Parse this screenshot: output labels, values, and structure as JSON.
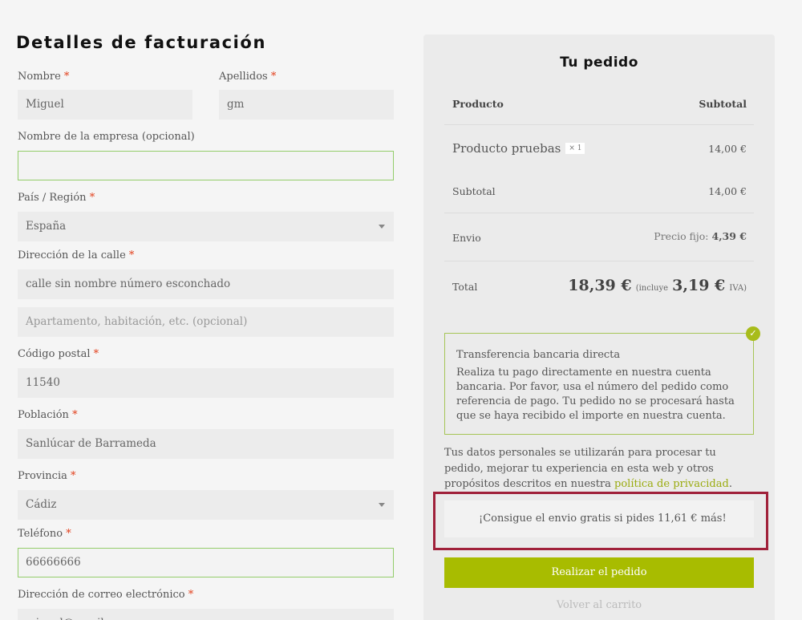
{
  "billing": {
    "title": "Detalles de facturación",
    "first_name": {
      "label": "Nombre",
      "value": "Miguel"
    },
    "last_name": {
      "label": "Apellidos",
      "value": "gm"
    },
    "company": {
      "label": "Nombre de la empresa (opcional)",
      "value": ""
    },
    "country": {
      "label": "País / Región",
      "value": "España"
    },
    "street": {
      "label": "Dirección de la calle",
      "value": "calle sin nombre número esconchado"
    },
    "apartment": {
      "placeholder": "Apartamento, habitación, etc. (opcional)"
    },
    "postcode": {
      "label": "Código postal",
      "value": "11540"
    },
    "city": {
      "label": "Población",
      "value": "Sanlúcar de Barrameda"
    },
    "state": {
      "label": "Provincia",
      "value": "Cádiz"
    },
    "phone": {
      "label": "Teléfono",
      "value": "66666666"
    },
    "email": {
      "label": "Dirección de correo electrónico",
      "value": "miguel@email.com"
    },
    "required_mark": "*"
  },
  "order": {
    "title": "Tu pedido",
    "header_product": "Producto",
    "header_subtotal": "Subtotal",
    "item_name": "Producto pruebas",
    "item_qty": "× 1",
    "item_price": "14,00 €",
    "subtotal_label": "Subtotal",
    "subtotal_value": "14,00 €",
    "shipping_label": "Envio",
    "shipping_method": "Precio fijo:",
    "shipping_value": "4,39 €",
    "total_label": "Total",
    "total_value": "18,39 €",
    "tax_prefix": "(incluye",
    "tax_value": "3,19 €",
    "tax_suffix": "IVA)",
    "payment_title": "Transferencia bancaria directa",
    "payment_desc": "Realiza tu pago directamente en nuestra cuenta bancaria. Por favor, usa el número del pedido como referencia de pago. Tu pedido no se procesará hasta que se haya recibido el importe en nuestra cuenta.",
    "privacy_text": "Tus datos personales se utilizarán para procesar tu pedido, mejorar tu experiencia en esta web y otros propósitos descritos en nuestra",
    "privacy_link": "política de privacidad",
    "privacy_end": ".",
    "free_shipping_notice": "¡Consigue el envio gratis si pides 11,61 € más!",
    "place_order": "Realizar el pedido",
    "back_to_cart": "Volver al carrito"
  },
  "colors": {
    "accent": "#a8bc00",
    "highlight_frame": "#a0213a",
    "required": "#e2401c"
  },
  "icons": {
    "select_caret": "chevron-down-icon",
    "payment_selected": "check-circle-icon"
  }
}
